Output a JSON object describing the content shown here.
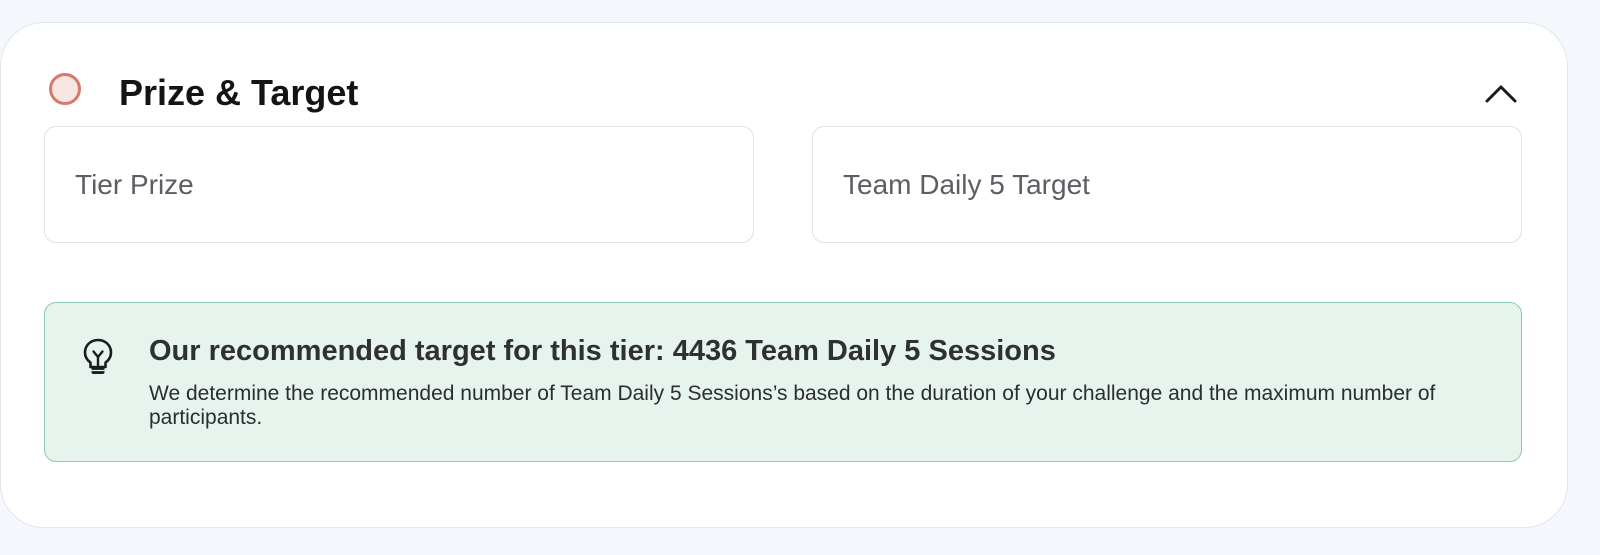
{
  "section": {
    "title": "Prize & Target",
    "status": "incomplete"
  },
  "fields": {
    "tier_prize_placeholder": "Tier Prize",
    "tier_prize_value": "",
    "target_placeholder": "Team Daily 5 Target",
    "target_value": ""
  },
  "recommendation": {
    "title": "Our recommended target for this tier: 4436 Team Daily 5 Sessions",
    "description": "We determine the recommended number of Team Daily 5 Sessions’s based on the duration of your challenge and the maximum number of participants."
  },
  "icons": {
    "status": "status-circle-icon",
    "collapse": "chevron-up-icon",
    "tip": "lightbulb-icon"
  },
  "colors": {
    "status_border": "#d9776b",
    "status_fill": "#f8e6e3",
    "info_bg": "#e7f4ee",
    "info_border": "#8ccbac"
  }
}
